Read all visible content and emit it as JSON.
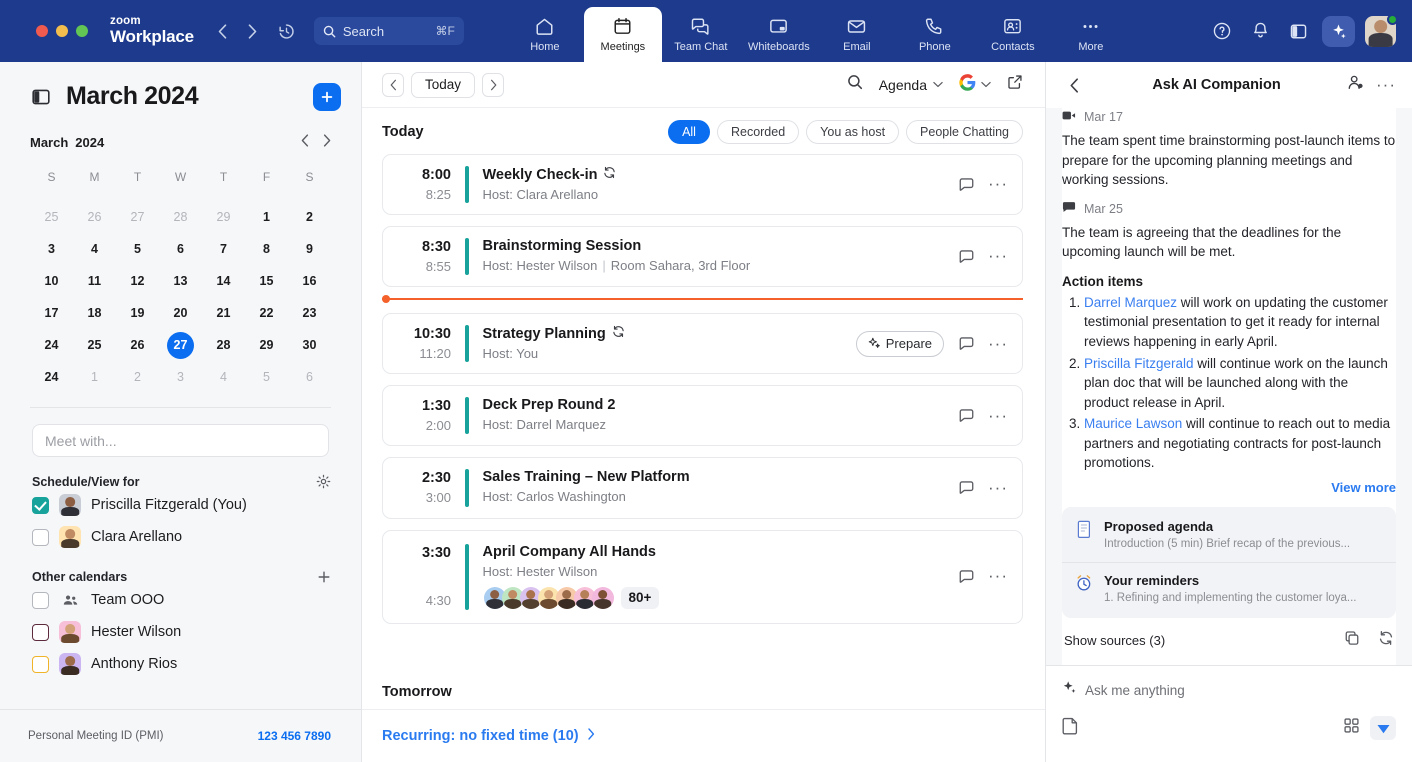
{
  "window": {
    "brand_top": "zoom",
    "brand_bottom": "Workplace",
    "search_placeholder": "Search",
    "search_shortcut": "⌘F"
  },
  "nav_tabs": [
    {
      "label": "Home",
      "icon": "home-icon",
      "active": false
    },
    {
      "label": "Meetings",
      "icon": "calendar-icon",
      "active": true
    },
    {
      "label": "Team Chat",
      "icon": "chat-icon",
      "active": false
    },
    {
      "label": "Whiteboards",
      "icon": "whiteboard-icon",
      "active": false
    },
    {
      "label": "Email",
      "icon": "envelope-icon",
      "active": false
    },
    {
      "label": "Phone",
      "icon": "phone-icon",
      "active": false
    },
    {
      "label": "Contacts",
      "icon": "contacts-icon",
      "active": false
    },
    {
      "label": "More",
      "icon": "ellipsis-icon",
      "active": false
    }
  ],
  "header_right_icons": [
    "help-icon",
    "bell-icon",
    "panel-icon",
    "ai-sparkle-icon",
    "avatar"
  ],
  "sidebar": {
    "title": "March 2024",
    "panel_toggle_icon": "panel-toggle-icon",
    "add_button_label": "+",
    "mini_calendar": {
      "month": "March",
      "year": "2024",
      "prev_icon": "chevron-left-icon",
      "next_icon": "chevron-right-icon",
      "day_headers": [
        "S",
        "M",
        "T",
        "W",
        "T",
        "F",
        "S"
      ],
      "selected_day": "27",
      "weeks": [
        [
          {
            "d": "25",
            "muted": true
          },
          {
            "d": "26",
            "muted": true
          },
          {
            "d": "27",
            "muted": true
          },
          {
            "d": "28",
            "muted": true
          },
          {
            "d": "29",
            "muted": true
          },
          {
            "d": "1",
            "muted": false
          },
          {
            "d": "2",
            "muted": false
          }
        ],
        [
          {
            "d": "3",
            "muted": false
          },
          {
            "d": "4",
            "muted": false
          },
          {
            "d": "5",
            "muted": false
          },
          {
            "d": "6",
            "muted": false
          },
          {
            "d": "7",
            "muted": false
          },
          {
            "d": "8",
            "muted": false
          },
          {
            "d": "9",
            "muted": false
          }
        ],
        [
          {
            "d": "10",
            "muted": false
          },
          {
            "d": "11",
            "muted": false
          },
          {
            "d": "12",
            "muted": false
          },
          {
            "d": "13",
            "muted": false
          },
          {
            "d": "14",
            "muted": false
          },
          {
            "d": "15",
            "muted": false
          },
          {
            "d": "16",
            "muted": false
          }
        ],
        [
          {
            "d": "17",
            "muted": false
          },
          {
            "d": "18",
            "muted": false
          },
          {
            "d": "19",
            "muted": false
          },
          {
            "d": "20",
            "muted": false
          },
          {
            "d": "21",
            "muted": false
          },
          {
            "d": "22",
            "muted": false
          },
          {
            "d": "23",
            "muted": false
          }
        ],
        [
          {
            "d": "24",
            "muted": false
          },
          {
            "d": "25",
            "muted": false
          },
          {
            "d": "26",
            "muted": false
          },
          {
            "d": "27",
            "muted": false,
            "selected": true
          },
          {
            "d": "28",
            "muted": false
          },
          {
            "d": "29",
            "muted": false
          },
          {
            "d": "30",
            "muted": false
          }
        ],
        [
          {
            "d": "24",
            "muted": false
          },
          {
            "d": "1",
            "muted": true
          },
          {
            "d": "2",
            "muted": true
          },
          {
            "d": "3",
            "muted": true
          },
          {
            "d": "4",
            "muted": true
          },
          {
            "d": "5",
            "muted": true
          },
          {
            "d": "6",
            "muted": true
          }
        ]
      ]
    },
    "meet_with_placeholder": "Meet with...",
    "schedule_section": {
      "title": "Schedule/View for",
      "settings_icon": "gear-icon",
      "people": [
        {
          "name": "Priscilla Fitzgerald (You)",
          "checked": true,
          "check_color": "#17a39b",
          "avatar_bg": "#c9cdd6"
        },
        {
          "name": "Clara Arellano",
          "checked": false,
          "check_color": "#b4b7bd",
          "avatar_bg": "#ffe3b0"
        }
      ]
    },
    "other_calendars": {
      "title": "Other calendars",
      "add_icon": "plus-icon",
      "items": [
        {
          "name": "Team OOO",
          "checked": false,
          "box_color": "#b4b7bd",
          "icon": "group-icon"
        },
        {
          "name": "Hester Wilson",
          "checked": false,
          "box_color": "#5c2a3c",
          "avatar_bg": "#f7c0d8"
        },
        {
          "name": "Anthony Rios",
          "checked": false,
          "box_color": "#f0b429",
          "avatar_bg": "#cbb6f2"
        }
      ]
    },
    "pmi": {
      "label": "Personal Meeting ID (PMI)",
      "value": "123 456 7890"
    }
  },
  "main": {
    "toolbar": {
      "prev_icon": "chevron-left-icon",
      "today_label": "Today",
      "next_icon": "chevron-right-icon",
      "search_icon": "search-icon",
      "view_label": "Agenda",
      "view_chevron": "chevron-down-icon",
      "google_icon": "google-icon",
      "google_chevron": "chevron-down-icon",
      "popout_icon": "external-link-icon"
    },
    "section_title": "Today",
    "filters": [
      {
        "label": "All",
        "active": true
      },
      {
        "label": "Recorded",
        "active": false
      },
      {
        "label": "You as host",
        "active": false
      },
      {
        "label": "People Chatting",
        "active": false
      }
    ],
    "meetings": [
      {
        "start": "8:00",
        "end": "8:25",
        "title": "Weekly Check-in",
        "recurring": true,
        "host": "Host: Clara Arellano",
        "room": "",
        "accent": "#17a39b",
        "has_prepare": false,
        "participants": [],
        "more_count": ""
      },
      {
        "start": "8:30",
        "end": "8:55",
        "title": "Brainstorming Session",
        "recurring": false,
        "host": "Host: Hester Wilson",
        "room": "Room Sahara, 3rd Floor",
        "accent": "#17a39b",
        "has_prepare": false,
        "participants": [],
        "more_count": ""
      },
      {
        "start": "10:30",
        "end": "11:20",
        "title": "Strategy Planning",
        "recurring": true,
        "host": "Host: You",
        "room": "",
        "accent": "#17a39b",
        "has_prepare": true,
        "prepare_label": "Prepare",
        "participants": [],
        "more_count": ""
      },
      {
        "start": "1:30",
        "end": "2:00",
        "title": "Deck Prep Round 2",
        "recurring": false,
        "host": "Host: Darrel Marquez",
        "room": "",
        "accent": "#17a39b",
        "has_prepare": false,
        "participants": [],
        "more_count": ""
      },
      {
        "start": "2:30",
        "end": "3:00",
        "title": "Sales Training – New Platform",
        "recurring": false,
        "host": "Host: Carlos Washington",
        "room": "",
        "accent": "#17a39b",
        "has_prepare": false,
        "participants": [],
        "more_count": ""
      },
      {
        "start": "3:30",
        "end": "4:30",
        "title": "April Company All Hands",
        "recurring": false,
        "host": "Host: Hester Wilson",
        "room": "",
        "accent": "#17a39b",
        "has_prepare": false,
        "participants": [
          "#a9cdf0",
          "#bfe6c2",
          "#d9c2f0",
          "#fbe3ad",
          "#f6c9a8",
          "#f7c0d8",
          "#f2b8dd"
        ],
        "more_count": "80+"
      }
    ],
    "now_indicator_color": "#f4612a",
    "tomorrow_title": "Tomorrow",
    "recurring_link": "Recurring: no fixed time (10)"
  },
  "ai_panel": {
    "back_icon": "chevron-left-icon",
    "title": "Ask AI Companion",
    "add_person_icon": "add-person-icon",
    "more_icon": "ellipsis-icon",
    "entries": [
      {
        "icon": "video-icon",
        "date": "Mar 17",
        "text": "The team spent time brainstorming post-launch items to prepare for the upcoming planning meetings and working sessions."
      },
      {
        "icon": "chat-bubble-icon",
        "date": "Mar 25",
        "text": "The team is agreeing that the deadlines for the upcoming launch will be met."
      }
    ],
    "action_items_title": "Action items",
    "action_items": [
      {
        "person": "Darrel Marquez",
        "rest": " will work on updating the customer testimonial presentation to get it ready for internal reviews happening in early April."
      },
      {
        "person": "Priscilla Fitzgerald",
        "rest": " will continue work on the launch plan doc that will be launched along with the product release in April."
      },
      {
        "person": "Maurice Lawson",
        "rest": " will continue to reach out to media partners and negotiating contracts for post-launch promotions."
      }
    ],
    "view_more": "View more",
    "cards": [
      {
        "icon": "agenda-doc-icon",
        "title": "Proposed agenda",
        "sub": "Introduction (5 min) Brief recap of the previous..."
      },
      {
        "icon": "reminder-clock-icon",
        "title": "Your reminders",
        "sub": "1. Refining and implementing the customer loya..."
      }
    ],
    "show_sources": "Show sources (3)",
    "copy_icon": "copy-icon",
    "regenerate_icon": "refresh-icon",
    "composer": {
      "sparkle_icon": "sparkle-icon",
      "placeholder": "Ask me anything",
      "attach_icon": "file-icon",
      "apps_icon": "grid-apps-icon",
      "send_icon": "send-icon"
    }
  },
  "colors": {
    "header_blue": "#1e3a8c",
    "accent_blue": "#0b6ef0",
    "link_blue": "#2a7af0",
    "teal": "#17a39b",
    "orange": "#f4612a"
  }
}
